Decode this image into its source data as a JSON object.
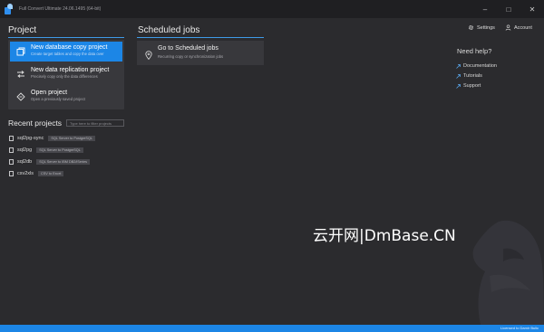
{
  "window": {
    "title": "Full Convert Ultimate 24.06.1495 (64-bit)",
    "controls": [
      "–",
      "□",
      "✕"
    ]
  },
  "project": {
    "title": "Project",
    "actions": [
      {
        "title": "New database copy project",
        "subtitle": "Create target tables and copy the data over",
        "icon": "database-copy-icon",
        "selected": true
      },
      {
        "title": "New data replication project",
        "subtitle": "Precisely copy only the data differences",
        "icon": "replication-arrows-icon",
        "selected": false
      },
      {
        "title": "Open project",
        "subtitle": "Open a previously saved project",
        "icon": "open-project-icon",
        "selected": false
      }
    ]
  },
  "recent": {
    "title": "Recent projects",
    "filter_placeholder": "Type here to filter projects",
    "items": [
      {
        "name": "sql2pg-sync",
        "tag": "SQL Server to PostgreSQL"
      },
      {
        "name": "sql2pg",
        "tag": "SQL Server to PostgreSQL"
      },
      {
        "name": "sql2db",
        "tag": "SQL Server to IBM DB2/iSeries"
      },
      {
        "name": "csv2xls",
        "tag": "CSV to Excel"
      }
    ]
  },
  "scheduled": {
    "title": "Scheduled jobs",
    "card_title": "Go to Scheduled jobs",
    "card_subtitle": "Recurring copy or synchronization jobs"
  },
  "top_links": {
    "settings": "Settings",
    "account": "Account"
  },
  "help": {
    "title": "Need help?",
    "links": [
      "Documentation",
      "Tutorials",
      "Support"
    ]
  },
  "watermark": "云开网|DmBase.CN",
  "status": {
    "license": "Licensed to Damir Bulic"
  },
  "colors": {
    "accent": "#1c86e6",
    "background": "#2b2b2e",
    "card": "#38383c"
  }
}
